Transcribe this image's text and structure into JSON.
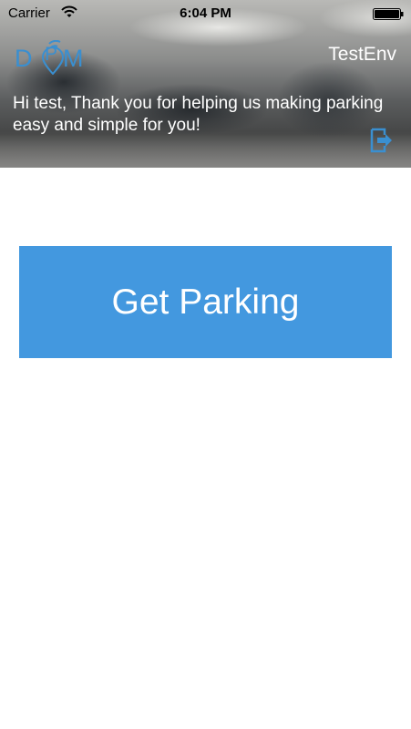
{
  "status_bar": {
    "carrier": "Carrier",
    "time": "6:04 PM",
    "icons": [
      "wifi-icon",
      "battery-icon"
    ]
  },
  "header": {
    "logo": {
      "letters": [
        "D",
        "P",
        "M"
      ]
    },
    "env_label": "TestEnv",
    "greeting": "Hi test, Thank you for helping us making parking easy and simple for you!",
    "logout_icon": "logout-icon"
  },
  "main": {
    "get_parking_label": "Get Parking"
  },
  "colors": {
    "accent": "#4398df",
    "logo": "#3a8fd0",
    "text_on_dark": "#ffffff"
  }
}
